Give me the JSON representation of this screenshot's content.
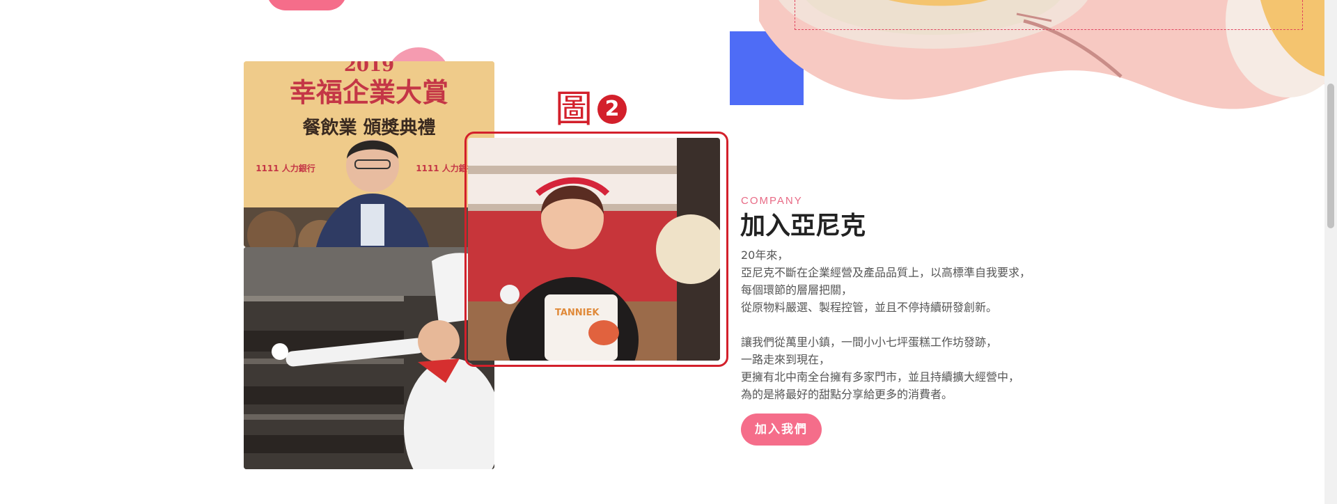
{
  "section": {
    "eyebrow": "COMPANY",
    "title": "加入亞尼克",
    "body_lines": [
      "20年來，",
      "亞尼克不斷在企業經營及產品品質上，以高標準自我要求，",
      "每個環節的層層把關，",
      "從原物料嚴選、製程控管，並且不停持續研發創新。",
      "",
      "讓我們從萬里小鎮，一間小小七坪蛋糕工作坊發跡，",
      "一路走來到現在，",
      "更擁有北中南全台擁有多家門市，並且持續擴大經營中，",
      "為的是將最好的甜點分享給更多的消費者。"
    ],
    "cta_label": "加入我們"
  },
  "photos": {
    "award": {
      "year": "2019",
      "title": "幸福企業大賞",
      "subtitle": "餐飲業 頒獎典禮",
      "sponsor": "1111 人力銀行"
    },
    "staff": {
      "cup_text": "TANNIEK"
    }
  },
  "annotation": {
    "label": "圖",
    "number": "2"
  },
  "colors": {
    "accent_pink": "#f56d8a",
    "annotation_red": "#d3202b",
    "hero_blue": "#4e6cf6"
  }
}
